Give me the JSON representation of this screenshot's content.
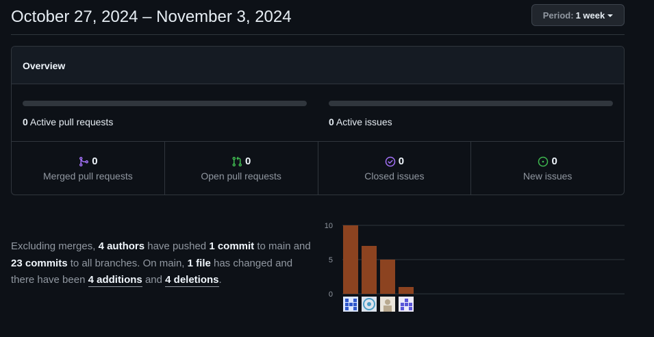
{
  "header": {
    "title": "October 27, 2024 – November 3, 2024",
    "period_label": "Period:",
    "period_value": "1 week"
  },
  "overview": {
    "title": "Overview",
    "active_prs_count": "0",
    "active_prs_label": "Active pull requests",
    "active_issues_count": "0",
    "active_issues_label": "Active issues",
    "stats": [
      {
        "count": "0",
        "label": "Merged pull requests",
        "icon": "merge-icon",
        "color": "#a371f7"
      },
      {
        "count": "0",
        "label": "Open pull requests",
        "icon": "pull-request-icon",
        "color": "#3fb950"
      },
      {
        "count": "0",
        "label": "Closed issues",
        "icon": "issue-closed-icon",
        "color": "#a371f7"
      },
      {
        "count": "0",
        "label": "New issues",
        "icon": "issue-opened-icon",
        "color": "#3fb950"
      }
    ]
  },
  "summary": {
    "t1": "Excluding merges, ",
    "authors": "4 authors",
    "t2": " have pushed ",
    "commit": "1 commit",
    "t3": " to main and ",
    "commits_all": "23 commits",
    "t4": " to all branches. On main, ",
    "files": "1 file",
    "t5": " has changed and there have been ",
    "additions_num": "4",
    "additions_word": " additions",
    "t6": " and ",
    "deletions_num": "4",
    "deletions_word": " deletions",
    "t7": "."
  },
  "colors": {
    "bar": "#8c4320",
    "grid": "#30363d",
    "additions": "#3fb950",
    "deletions": "#f85149"
  },
  "chart_data": {
    "type": "bar",
    "categories": [
      "author-1",
      "author-2",
      "author-3",
      "author-4"
    ],
    "values": [
      10,
      7,
      5,
      1
    ],
    "ylim": [
      0,
      10
    ],
    "yticks": [
      "10",
      "5",
      "0"
    ],
    "grid": true,
    "avatars": [
      "identicon-blue",
      "avatar-globe",
      "avatar-photo",
      "identicon-purple"
    ]
  }
}
